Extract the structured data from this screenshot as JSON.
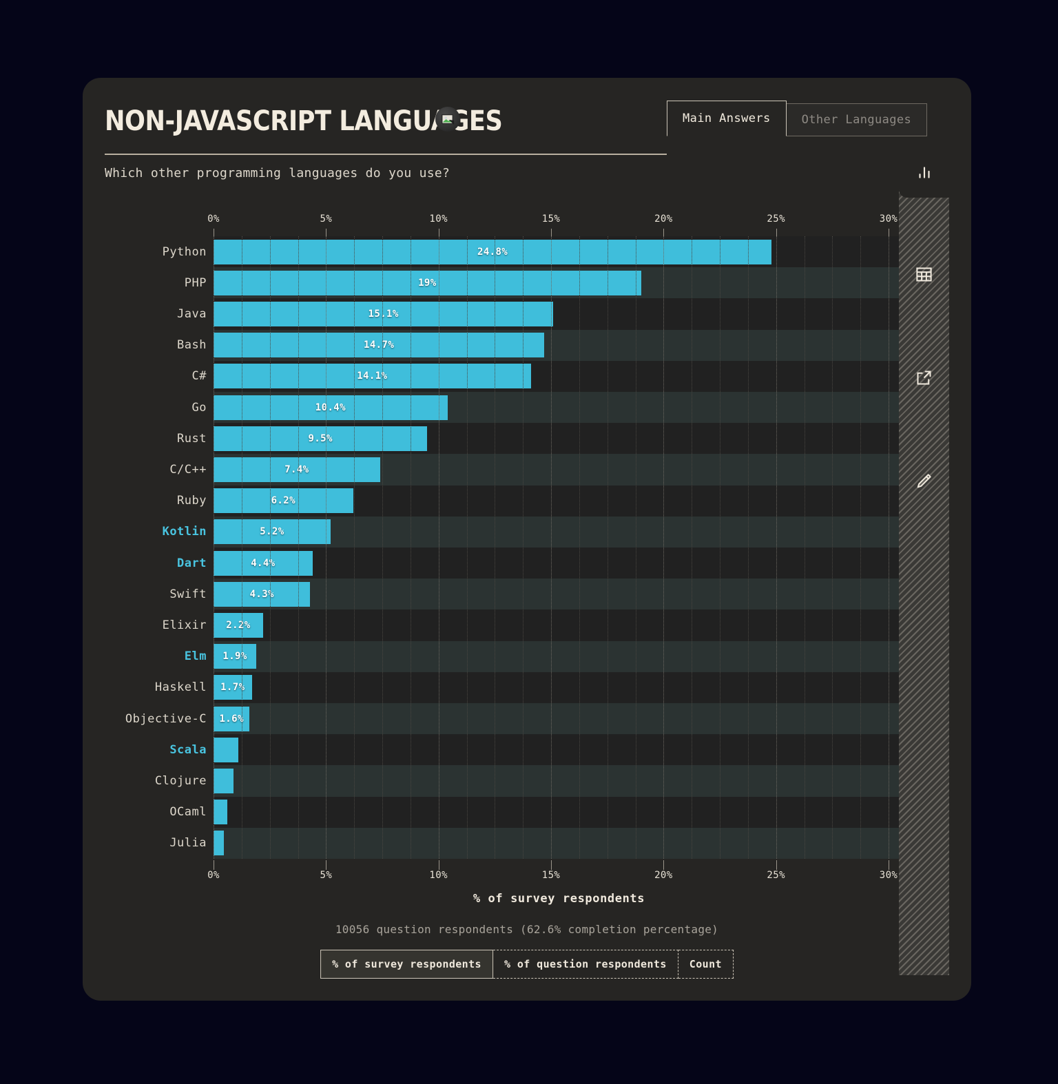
{
  "header": {
    "title": "NON-JAVASCRIPT LANGUAGES",
    "badge_icon": "image-placeholder-icon",
    "tabs": [
      {
        "label": "Main Answers",
        "active": true
      },
      {
        "label": "Other Languages",
        "active": false
      }
    ]
  },
  "question": "Which other programming languages do you use?",
  "sidebar": {
    "items": [
      {
        "icon": "bar-chart-icon",
        "active": true
      },
      {
        "icon": "table-icon",
        "active": false
      },
      {
        "icon": "external-link-icon",
        "active": false
      },
      {
        "icon": "pencil-edit-icon",
        "active": false
      }
    ]
  },
  "footer": {
    "note": "10056 question respondents (62.6% completion percentage)",
    "segments": [
      {
        "label": "% of survey respondents",
        "active": true
      },
      {
        "label": "% of question respondents",
        "active": false
      },
      {
        "label": "Count",
        "active": false
      }
    ]
  },
  "colors": {
    "bar": "#3fbedb",
    "highlight": "#49c4e0",
    "card": "#262523",
    "page": "#050518",
    "text": "#f0e9dd"
  },
  "chart_data": {
    "type": "bar",
    "orientation": "horizontal",
    "title": "NON-JAVASCRIPT LANGUAGES",
    "subtitle": "Which other programming languages do you use?",
    "xlabel": "% of survey respondents",
    "ylabel": "",
    "xlim": [
      0,
      30
    ],
    "xticks": [
      0,
      5,
      10,
      15,
      20,
      25,
      30
    ],
    "xticklabels": [
      "0%",
      "5%",
      "10%",
      "15%",
      "20%",
      "25%",
      "30%"
    ],
    "grid": true,
    "legend": false,
    "categories": [
      "Python",
      "PHP",
      "Java",
      "Bash",
      "C#",
      "Go",
      "Rust",
      "C/C++",
      "Ruby",
      "Kotlin",
      "Dart",
      "Swift",
      "Elixir",
      "Elm",
      "Haskell",
      "Objective-C",
      "Scala",
      "Clojure",
      "OCaml",
      "Julia"
    ],
    "values": [
      24.8,
      19,
      15.1,
      14.7,
      14.1,
      10.4,
      9.5,
      7.4,
      6.2,
      5.2,
      4.4,
      4.3,
      2.2,
      1.9,
      1.7,
      1.6,
      1.1,
      0.9,
      0.6,
      0.45
    ],
    "labels": [
      "24.8%",
      "19%",
      "15.1%",
      "14.7%",
      "14.1%",
      "10.4%",
      "9.5%",
      "7.4%",
      "6.2%",
      "5.2%",
      "4.4%",
      "4.3%",
      "2.2%",
      "1.9%",
      "1.7%",
      "1.6%",
      "",
      "",
      "",
      ""
    ],
    "highlighted": [
      "Kotlin",
      "Dart",
      "Elm",
      "Scala"
    ]
  }
}
